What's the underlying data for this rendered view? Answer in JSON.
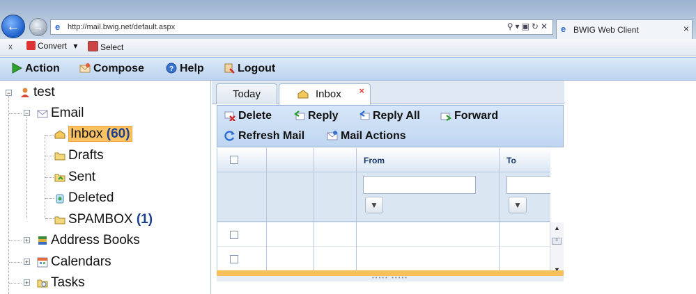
{
  "browser": {
    "url": "http://mail.bwig.net/default.aspx",
    "tab_title": "BWIG Web Client",
    "tab_close": "×",
    "command_bar": {
      "close": "x",
      "convert": "Convert",
      "select": "Select"
    }
  },
  "toolbar": {
    "action": "Action",
    "compose": "Compose",
    "help": "Help",
    "logout": "Logout"
  },
  "tree": {
    "root": "test",
    "email": "Email",
    "inbox": {
      "label": "Inbox",
      "count": "(60)"
    },
    "drafts": "Drafts",
    "sent": "Sent",
    "deleted": "Deleted",
    "spambox": {
      "label": "SPAMBOX",
      "count": "(1)"
    },
    "address_books": "Address Books",
    "calendars": "Calendars",
    "tasks": "Tasks"
  },
  "tabs": [
    {
      "label": "Today"
    },
    {
      "label": "Inbox",
      "close": "×"
    }
  ],
  "mail_toolbar": {
    "delete": "Delete",
    "reply": "Reply",
    "reply_all": "Reply All",
    "forward": "Forward",
    "refresh": "Refresh Mail",
    "actions": "Mail Actions"
  },
  "grid": {
    "columns": [
      "",
      "",
      "",
      "From",
      "To"
    ]
  },
  "colors": {
    "accent_blue": "#1a3f8f",
    "selected_orange": "#fbc263",
    "toolbar_bg": "#c9dcf4"
  }
}
